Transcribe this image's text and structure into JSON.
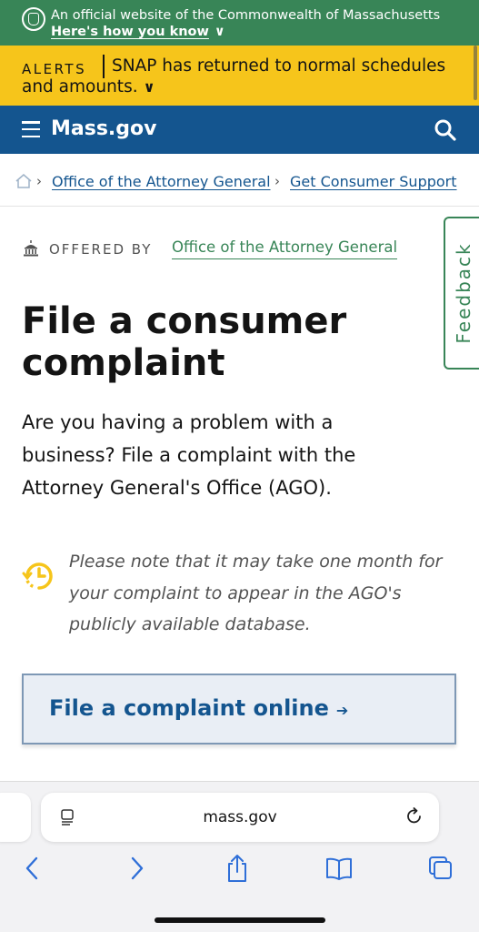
{
  "banner": {
    "official_text": "An official website of the Commonwealth of Massachusetts",
    "how_link": "Here's how you know"
  },
  "alerts": {
    "label": "ALERTS",
    "message": "SNAP has returned to normal schedules and amounts."
  },
  "header": {
    "logo": "Mass.gov"
  },
  "breadcrumbs": {
    "items": [
      "Office of the Attorney General",
      "Get Consumer Support"
    ]
  },
  "offered_by": {
    "label": "OFFERED BY",
    "org": "Office of the Attorney General"
  },
  "feedback": {
    "label": "Feedback"
  },
  "page": {
    "title": "File a consumer complaint",
    "lede": "Are you having a problem with a business? File a complaint with the Attorney General's Office (AGO).",
    "note": "Please note that it may take one month for your complaint to appear in the AGO's publicly available database.",
    "cta": "File a complaint online"
  },
  "browser": {
    "url": "mass.gov"
  },
  "colors": {
    "official_green": "#388557",
    "alert_yellow": "#f6c51b",
    "header_blue": "#14558f",
    "note_icon": "#f6c51b"
  },
  "icons": {
    "menu": "hamburger-icon",
    "search": "search-icon",
    "home": "home-icon",
    "building": "building-icon",
    "clock": "clock-icon",
    "back": "chevron-left-icon",
    "forward": "chevron-right-icon",
    "share": "share-icon",
    "bookmarks": "book-icon",
    "tabs": "tabs-icon"
  }
}
